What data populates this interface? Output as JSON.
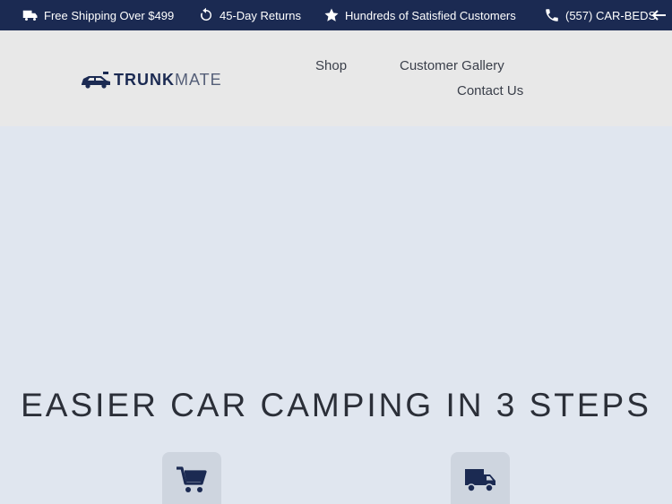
{
  "topbar": {
    "shipping": "Free Shipping Over $499",
    "returns": "45-Day Returns",
    "customers": "Hundreds of Satisfied Customers",
    "phone": "(557) CAR-BEDS"
  },
  "logo": {
    "part1": "TRUNK",
    "part2": "MATE"
  },
  "nav": {
    "shop": "Shop",
    "gallery": "Customer Gallery",
    "contact": "Contact Us"
  },
  "hero": {
    "title": "EASIER CAR CAMPING IN 3 STEPS"
  },
  "steps": [
    {
      "icon": "cart-icon"
    },
    {
      "icon": "truck-icon"
    }
  ],
  "colors": {
    "topbar": "#1b2a52",
    "header": "#e8e8e8",
    "hero_bg": "#e0e6ef",
    "step_card": "#ced5df"
  }
}
